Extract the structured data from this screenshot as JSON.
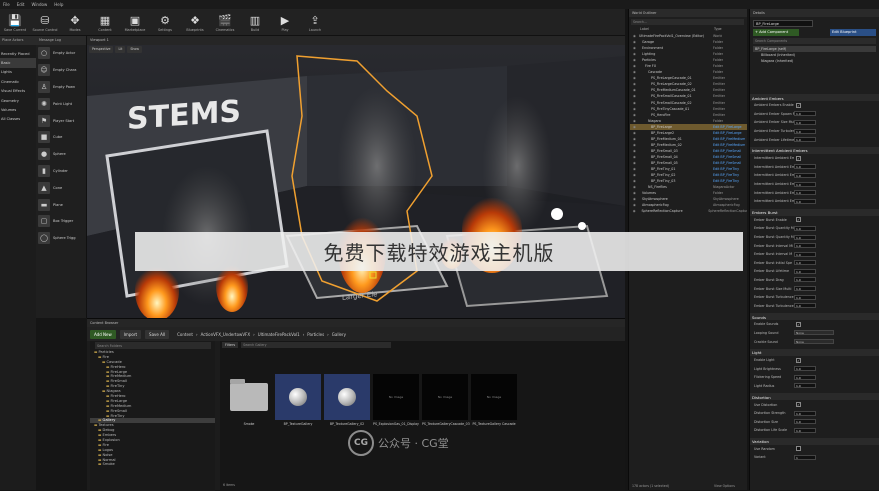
{
  "menu": [
    "File",
    "Edit",
    "Window",
    "Help"
  ],
  "toolbar": [
    {
      "label": "Save Current",
      "icon": "save-icon"
    },
    {
      "label": "Source Control",
      "icon": "source-control-icon"
    },
    {
      "label": "Modes",
      "icon": "modes-icon"
    },
    {
      "label": "Content",
      "icon": "content-icon"
    },
    {
      "label": "Marketplace",
      "icon": "marketplace-icon"
    },
    {
      "label": "Settings",
      "icon": "settings-icon"
    },
    {
      "label": "Blueprints",
      "icon": "blueprints-icon"
    },
    {
      "label": "Cinematics",
      "icon": "cinematics-icon"
    },
    {
      "label": "Build",
      "icon": "build-icon"
    },
    {
      "label": "Play",
      "icon": "play-icon"
    },
    {
      "label": "Launch",
      "icon": "launch-icon"
    }
  ],
  "modes": {
    "tab": "Place Actors",
    "items": [
      "Recently Placed",
      "Basic",
      "Lights",
      "Cinematic",
      "Visual Effects",
      "Geometry",
      "Volumes",
      "All Classes"
    ]
  },
  "place": {
    "tab": "Message Log",
    "items": [
      "Empty Actor",
      "Empty Chara",
      "Empty Pawn",
      "Point Light",
      "Player Start",
      "Cube",
      "Sphere",
      "Cylinder",
      "Cone",
      "Plane",
      "Box Trigger",
      "Sphere Trigg"
    ]
  },
  "viewport": {
    "tab": "Viewport 1",
    "buttons": [
      "Perspective",
      "Lit",
      "Show"
    ],
    "sign": "STEMS",
    "floor_label": "Larger Ele"
  },
  "content_browser": {
    "tab": "Content Browser",
    "add_new": "Add New",
    "import": "Import",
    "save_all": "Save All",
    "path": [
      "Content",
      "ActionVFX_UndertowVFX",
      "UltimateFirePackVol1",
      "Particles",
      "Gallery"
    ],
    "filters": "Filters",
    "search_placeholder": "Search Gallery",
    "tree_search": "Search Folders",
    "tree": [
      "Particles",
      "Fire",
      "Cascade",
      "FireHero",
      "FireLarge",
      "FireMedium",
      "FireSmall",
      "FireTiny",
      "Niagara",
      "FireHero",
      "FireLarge",
      "FireMedium",
      "FireSmall",
      "FireTiny",
      "Gallery",
      "Textures",
      "Debug",
      "Embers",
      "Explosion",
      "Fire",
      "Logos",
      "Noise",
      "Normal",
      "Smoke"
    ],
    "tiles": [
      {
        "name": "Smoke",
        "kind": "folder"
      },
      {
        "name": "BP_TextureGallery",
        "kind": "sphere"
      },
      {
        "name": "BP_TextureGallery_02",
        "kind": "sphere"
      },
      {
        "name": "PS_ExplosionGas_01_Display",
        "kind": "noimage"
      },
      {
        "name": "PS_TextureGalleryCascade_03",
        "kind": "noimage"
      },
      {
        "name": "PS_TextureGallery Cascade",
        "kind": "noimage"
      }
    ],
    "no_image": "No Image",
    "status": "6 items"
  },
  "outliner": {
    "tab": "World Outliner",
    "search_placeholder": "Search...",
    "col_label": "Label",
    "col_type": "Type",
    "rows": [
      {
        "name": "UltimateFirePackVol1_Overview (Editor)",
        "type": "World",
        "cls": ""
      },
      {
        "name": "Garage",
        "type": "Folder",
        "cls": ""
      },
      {
        "name": "Environment",
        "type": "Folder",
        "cls": ""
      },
      {
        "name": "Lighting",
        "type": "Folder",
        "cls": ""
      },
      {
        "name": "Particles",
        "type": "Folder",
        "cls": ""
      },
      {
        "name": "Fire FX",
        "type": "Folder",
        "cls": ""
      },
      {
        "name": "Cascade",
        "type": "Folder",
        "cls": ""
      },
      {
        "name": "PS_FireLargeCascade_01",
        "type": "Emitter",
        "cls": ""
      },
      {
        "name": "PS_FireLargeCascade_02",
        "type": "Emitter",
        "cls": ""
      },
      {
        "name": "PS_FireMediumCascade_01",
        "type": "Emitter",
        "cls": ""
      },
      {
        "name": "PS_FireSmallCascade_01",
        "type": "Emitter",
        "cls": ""
      },
      {
        "name": "PS_FireSmallCascade_02",
        "type": "Emitter",
        "cls": ""
      },
      {
        "name": "PS_FireTinyCascade_01",
        "type": "Emitter",
        "cls": ""
      },
      {
        "name": "PS_HeroFire",
        "type": "Emitter",
        "cls": ""
      },
      {
        "name": "Niagara",
        "type": "Folder",
        "cls": ""
      },
      {
        "name": "BP_FireLarge",
        "type": "Edit BP_FireLarge",
        "cls": "hl blue"
      },
      {
        "name": "BP_FireLarge2",
        "type": "Edit BP_FireLarge",
        "cls": "blue"
      },
      {
        "name": "BP_FireMedium_01",
        "type": "Edit BP_FireMedium",
        "cls": "blue"
      },
      {
        "name": "BP_FireMedium_02",
        "type": "Edit BP_FireMedium",
        "cls": "blue"
      },
      {
        "name": "BP_FireSmall_03",
        "type": "Edit BP_FireSmall",
        "cls": "blue"
      },
      {
        "name": "BP_FireSmall_04",
        "type": "Edit BP_FireSmall",
        "cls": "blue"
      },
      {
        "name": "BP_FireSmall_05",
        "type": "Edit BP_FireSmall",
        "cls": "blue"
      },
      {
        "name": "BP_FireTiny_01",
        "type": "Edit BP_FireTiny",
        "cls": "blue"
      },
      {
        "name": "BP_FireTiny_02",
        "type": "Edit BP_FireTiny",
        "cls": "blue"
      },
      {
        "name": "BP_FireTiny_03",
        "type": "Edit BP_FireTiny",
        "cls": "blue"
      },
      {
        "name": "NS_Fireflies",
        "type": "NiagaraActor",
        "cls": ""
      },
      {
        "name": "Volumes",
        "type": "Folder",
        "cls": ""
      },
      {
        "name": "SkyAtmosphere",
        "type": "SkyAtmosphere",
        "cls": ""
      },
      {
        "name": "AtmosphericFog",
        "type": "AtmosphericFog",
        "cls": ""
      },
      {
        "name": "SphereReflectionCapture",
        "type": "SphereReflectionCapture",
        "cls": ""
      }
    ],
    "status": "178 actors (1 selected)",
    "view_options": "View Options"
  },
  "details": {
    "tab": "Details",
    "name_value": "BP_FireLarge",
    "add_component": "+ Add Component",
    "edit_blueprint": "Edit Blueprint",
    "search_placeholder": "Search Components",
    "components": [
      "BP_FireLarge (self)",
      "Billboard (Inherited)",
      "Niagara (Inherited)"
    ],
    "sections": [
      {
        "title": "Ambient Embers",
        "props": [
          {
            "label": "Ambient Embers Enable",
            "kind": "check",
            "value": "✓"
          },
          {
            "label": "Ambient Ember Spawn Rat",
            "kind": "num",
            "value": "1.0"
          },
          {
            "label": "Ambient Ember Size Mul",
            "kind": "num",
            "value": "1.0"
          },
          {
            "label": "Ambient Ember Turbulen",
            "kind": "num",
            "value": "1.0"
          },
          {
            "label": "Ambient Ember Lifetime",
            "kind": "num",
            "value": "1.0"
          }
        ]
      },
      {
        "title": "Intermittent Ambient Embers",
        "props": [
          {
            "label": "Intermittent Ambient Em",
            "kind": "check",
            "value": "✓"
          },
          {
            "label": "Intermittent Ambient Em",
            "kind": "num",
            "value": "1.0"
          },
          {
            "label": "Intermittent Ambient Em",
            "kind": "num",
            "value": "1.0"
          },
          {
            "label": "Intermittent Ambient Em",
            "kind": "num",
            "value": "1.0"
          },
          {
            "label": "Intermittent Ambient Em",
            "kind": "num",
            "value": "1.0"
          },
          {
            "label": "Intermittent Ambient Em",
            "kind": "num",
            "value": "1.0"
          }
        ]
      },
      {
        "title": "Embers Burst",
        "props": [
          {
            "label": "Ember Burst Enable",
            "kind": "check",
            "value": "✓"
          },
          {
            "label": "Ember Burst Quantity M",
            "kind": "num",
            "value": "1.0"
          },
          {
            "label": "Ember Burst Quantity M",
            "kind": "num",
            "value": "1.0"
          },
          {
            "label": "Ember Burst Interval Mi",
            "kind": "num",
            "value": "1.0"
          },
          {
            "label": "Ember Burst Interval M",
            "kind": "num",
            "value": "1.0"
          },
          {
            "label": "Ember Burst Initial Spe",
            "kind": "num",
            "value": "1.0"
          },
          {
            "label": "Ember Burst Lifetime",
            "kind": "num",
            "value": "1.0"
          },
          {
            "label": "Ember Burst Drag",
            "kind": "num",
            "value": "1.0"
          },
          {
            "label": "Ember Burst Size Multi",
            "kind": "num",
            "value": "1.0"
          },
          {
            "label": "Ember Burst Turbulence",
            "kind": "num",
            "value": "1.0"
          },
          {
            "label": "Ember Burst Turbulence",
            "kind": "num",
            "value": "1.0"
          }
        ]
      },
      {
        "title": "Sounds",
        "props": [
          {
            "label": "Enable Sounds",
            "kind": "check",
            "value": "✓"
          },
          {
            "label": "Looping Sound",
            "kind": "drop",
            "value": "None"
          },
          {
            "label": "Crackle Sound",
            "kind": "drop",
            "value": "None"
          }
        ]
      },
      {
        "title": "Light",
        "props": [
          {
            "label": "Enable Light",
            "kind": "check",
            "value": "✓"
          },
          {
            "label": "Light Brightness",
            "kind": "num",
            "value": "1.0"
          },
          {
            "label": "Flickering Speed",
            "kind": "num",
            "value": "1.0"
          },
          {
            "label": "Light Radius",
            "kind": "num",
            "value": "1.0"
          }
        ]
      },
      {
        "title": "Distortion",
        "props": [
          {
            "label": "Use Distortion",
            "kind": "check",
            "value": "✓"
          },
          {
            "label": "Distortion Strength",
            "kind": "num",
            "value": "1.0"
          },
          {
            "label": "Distortion Size",
            "kind": "num",
            "value": "1.0"
          },
          {
            "label": "Distortion Life Scale",
            "kind": "num",
            "value": "1.0"
          }
        ]
      },
      {
        "title": "Variation",
        "props": [
          {
            "label": "Use Random",
            "kind": "check",
            "value": ""
          },
          {
            "label": "Variant",
            "kind": "num",
            "value": "1"
          }
        ]
      }
    ]
  },
  "overlay": {
    "banner": "免费下载特效游戏主机版",
    "watermark": "公众号 · CG堂"
  }
}
